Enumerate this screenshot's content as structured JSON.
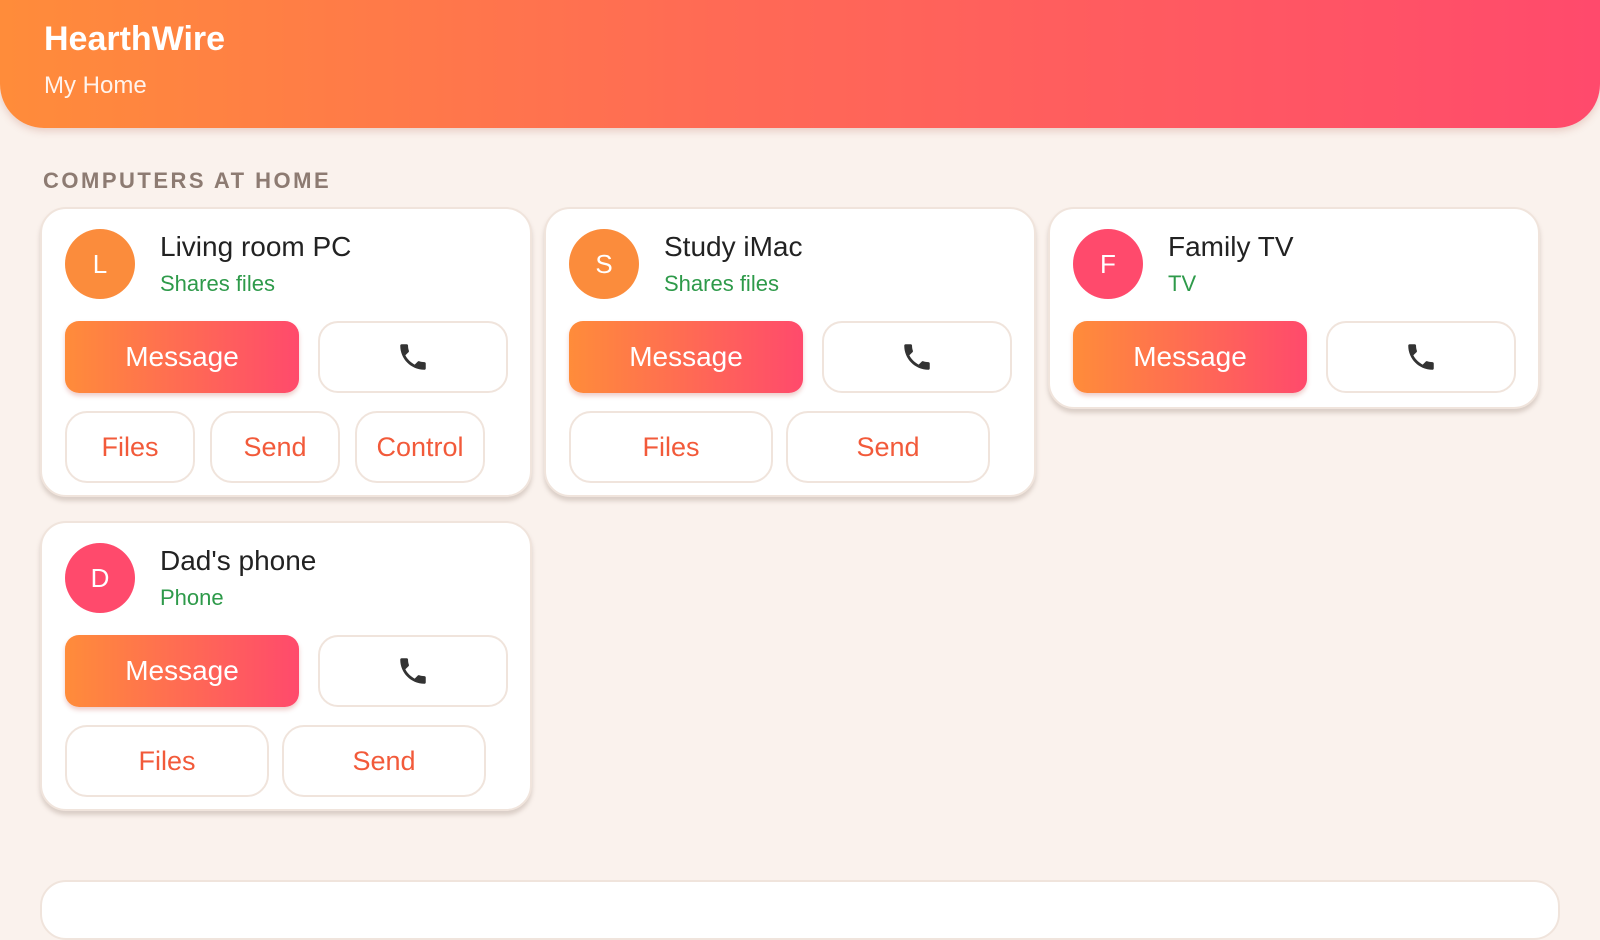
{
  "header": {
    "title": "HearthWire",
    "subtitle": "My Home",
    "gradient_start": "#ff8c3a",
    "gradient_end": "#ff4a6c"
  },
  "section": {
    "title": "COMPUTERS AT HOME"
  },
  "devices": [
    {
      "initial": "L",
      "name": "Living room PC",
      "type": "Shares files",
      "avatar_color": "#fb8c3c",
      "message_label": "Message",
      "call_icon": "phone-icon",
      "actions": [
        "Files",
        "Send",
        "Control"
      ]
    },
    {
      "initial": "S",
      "name": "Study iMac",
      "type": "Shares files",
      "avatar_color": "#fb8c3c",
      "message_label": "Message",
      "call_icon": "phone-icon",
      "actions": [
        "Files",
        "Send"
      ]
    },
    {
      "initial": "F",
      "name": "Family TV",
      "type": "TV",
      "avatar_color": "#ff4a6c",
      "message_label": "Message",
      "call_icon": "phone-icon",
      "actions": []
    },
    {
      "initial": "D",
      "name": "Dad's phone",
      "type": "Phone",
      "avatar_color": "#ff4a6c",
      "message_label": "Message",
      "call_icon": "phone-icon",
      "actions": [
        "Files",
        "Send"
      ]
    }
  ],
  "colors": {
    "accent": "#f25a3a",
    "status_green": "#2e9a4a",
    "background": "#faf2ed"
  }
}
